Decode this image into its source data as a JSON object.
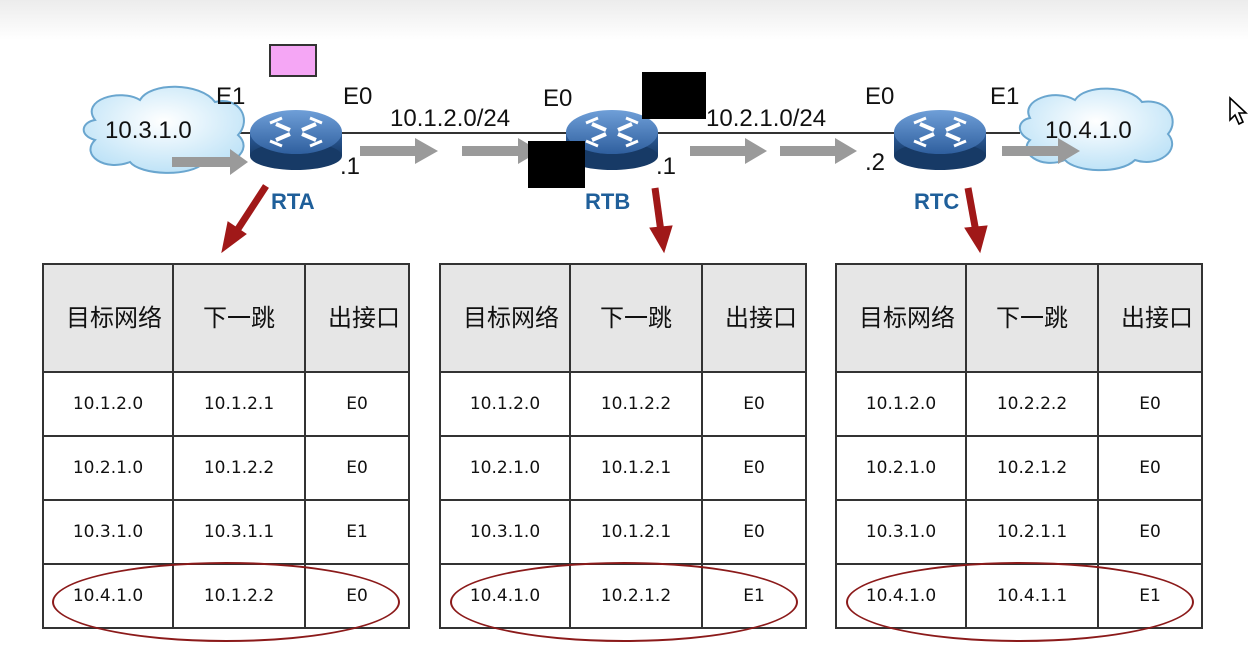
{
  "networks": {
    "left": "10.3.1.0",
    "right": "10.4.1.0",
    "link_ab": "10.1.2.0/24",
    "link_bc": "10.2.1.0/24"
  },
  "interfaces": {
    "rta_e1": "E1",
    "rta_e0": "E0",
    "rtb_e0": "E0",
    "rtc_e0": "E0",
    "rtc_e1": "E1",
    "rta_addr": ".1",
    "rtb_addr": ".1",
    "rtc_addr": ".2"
  },
  "routers": [
    "RTA",
    "RTB",
    "RTC"
  ],
  "table_headers": [
    "目标网络",
    "下一跳",
    "出接口"
  ],
  "tables": [
    {
      "router": "RTA",
      "rows": [
        [
          "10.1.2.0",
          "10.1.2.1",
          "E0"
        ],
        [
          "10.2.1.0",
          "10.1.2.2",
          "E0"
        ],
        [
          "10.3.1.0",
          "10.3.1.1",
          "E1"
        ],
        [
          "10.4.1.0",
          "10.1.2.2",
          "E0"
        ]
      ]
    },
    {
      "router": "RTB",
      "rows": [
        [
          "10.1.2.0",
          "10.1.2.2",
          "E0"
        ],
        [
          "10.2.1.0",
          "10.1.2.1",
          "E0"
        ],
        [
          "10.3.1.0",
          "10.1.2.1",
          "E0"
        ],
        [
          "10.4.1.0",
          "10.2.1.2",
          "E1"
        ]
      ]
    },
    {
      "router": "RTC",
      "rows": [
        [
          "10.1.2.0",
          "10.2.2.2",
          "E0"
        ],
        [
          "10.2.1.0",
          "10.2.1.2",
          "E0"
        ],
        [
          "10.3.1.0",
          "10.2.1.1",
          "E0"
        ],
        [
          "10.4.1.0",
          "10.4.1.1",
          "E1"
        ]
      ]
    }
  ],
  "colors": {
    "router_body": "#2f5f9e",
    "router_label": "#1f5f9a",
    "arrow_gray": "#9a9a9a",
    "arrow_red": "#a01818",
    "highlight_ellipse": "#8b1a1a",
    "header_bg": "#e6e6e6",
    "marker_pink": "#f5a6f5"
  },
  "icons": [
    "cloud-icon",
    "router-icon",
    "arrow-icon",
    "cursor-icon"
  ]
}
